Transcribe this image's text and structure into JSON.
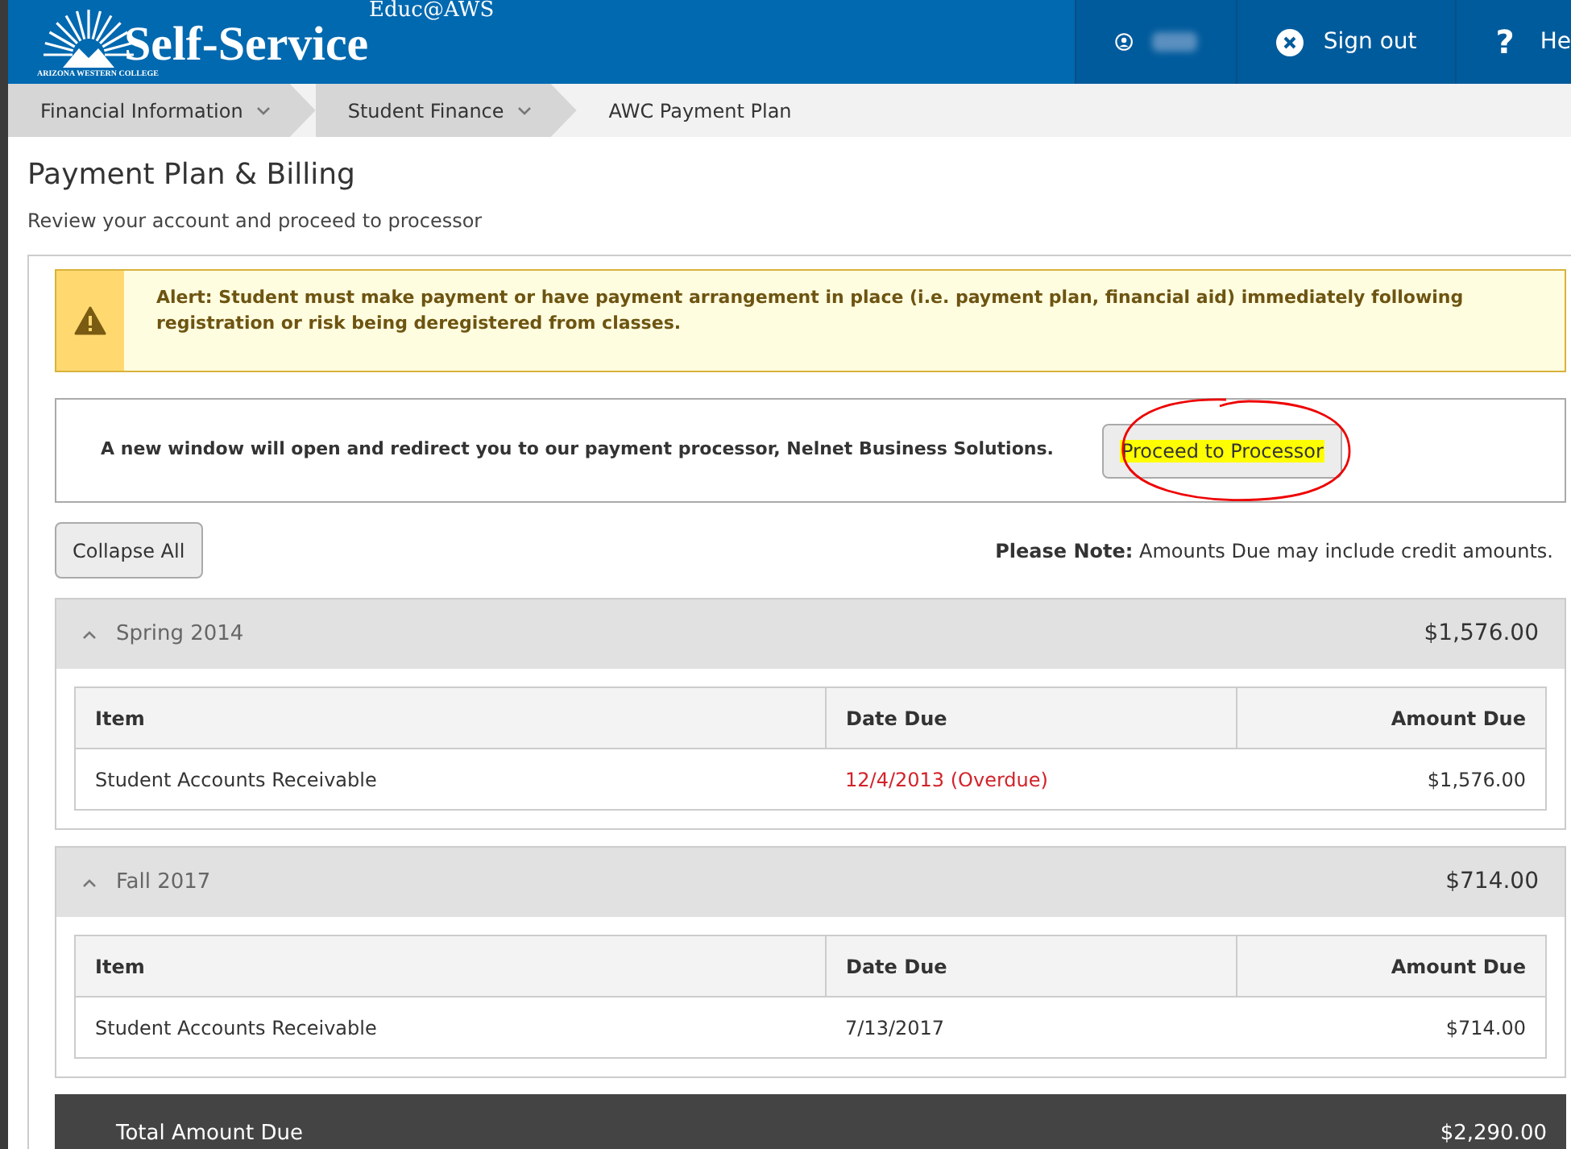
{
  "header": {
    "logo": {
      "top": "Educ@AWS",
      "main": "Self-Service",
      "sub": "ARIZONA WESTERN COLLEGE"
    },
    "nav": [
      {
        "kind": "user"
      },
      {
        "kind": "signout",
        "label": "Sign out"
      },
      {
        "kind": "help",
        "icon": "?",
        "label": "He"
      }
    ]
  },
  "breadcrumbs": [
    {
      "label": "Financial Information",
      "dropdown": true
    },
    {
      "label": "Student Finance",
      "dropdown": true
    },
    {
      "label": "AWC Payment Plan",
      "dropdown": false
    }
  ],
  "page": {
    "title": "Payment Plan & Billing",
    "subtitle": "Review your account and proceed to processor"
  },
  "alert": "Alert: Student must make payment or have payment arrangement in place (i.e. payment plan, financial aid) immediately following registration or risk being deregistered from classes.",
  "processor": {
    "message": "A new window will open and redirect you to our payment processor, Nelnet Business Solutions.",
    "button": "Proceed to Processor",
    "highlighted": true
  },
  "collapse_button": "Collapse All",
  "note": "**Please Note:** Amounts Due may include credit amounts.",
  "terms": [
    {
      "name": "Spring 2014",
      "total": "$1,576.00",
      "expanded": true,
      "columns": [
        "Item",
        "Date Due",
        "Amount Due"
      ],
      "rows": [
        {
          "item": "Student Accounts Receivable",
          "date_due": "12/4/2013 (Overdue)",
          "overdue": true,
          "amount": "$1,576.00"
        }
      ]
    },
    {
      "name": "Fall 2017",
      "total": "$714.00",
      "expanded": true,
      "columns": [
        "Item",
        "Date Due",
        "Amount Due"
      ],
      "rows": [
        {
          "item": "Student Accounts Receivable",
          "date_due": "7/13/2017",
          "overdue": false,
          "amount": "$714.00"
        }
      ]
    }
  ],
  "total": {
    "label": "Total Amount Due",
    "amount": "$2,290.00"
  }
}
